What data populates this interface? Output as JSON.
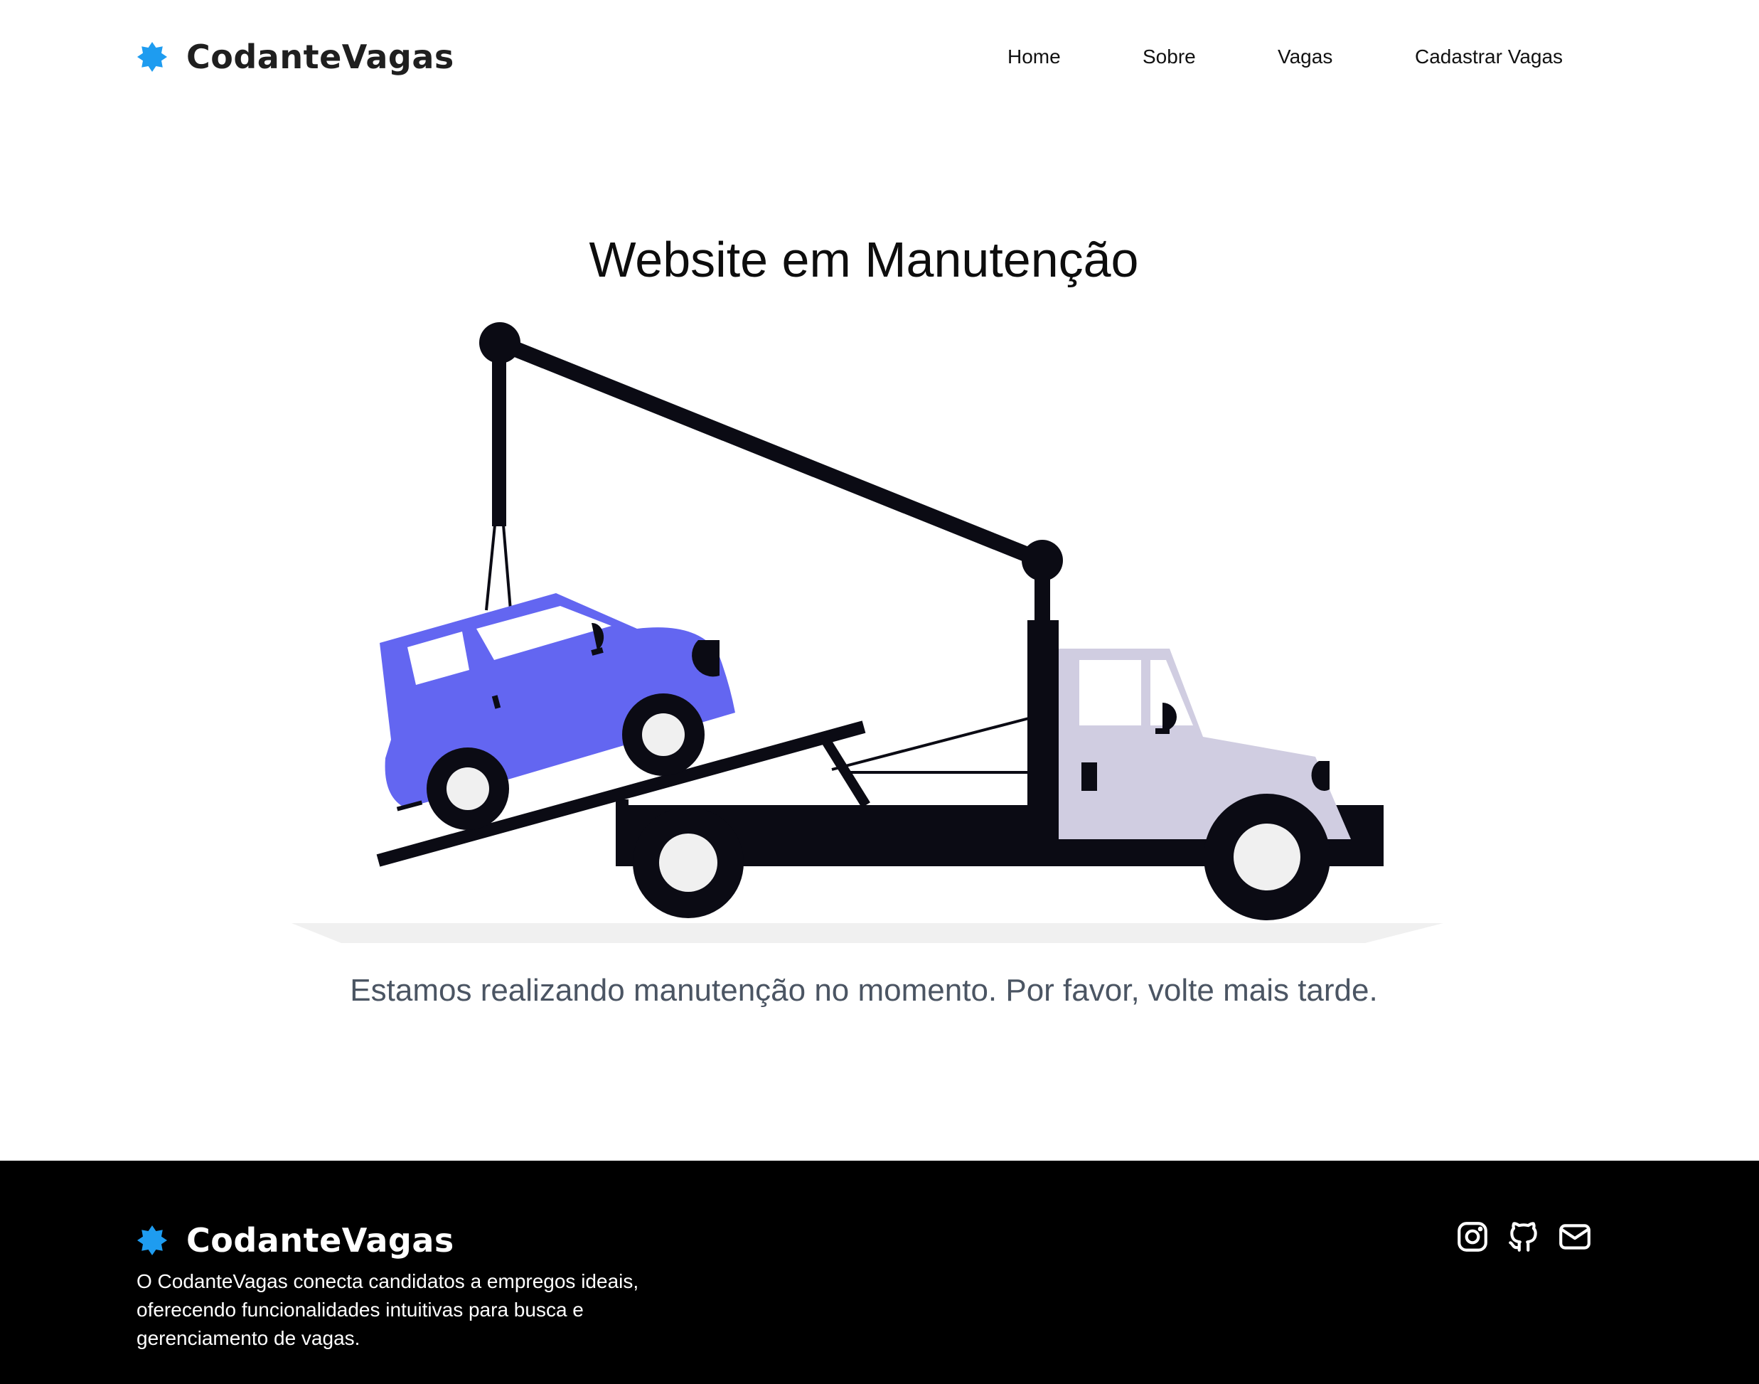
{
  "header": {
    "brand": "CodanteVagas",
    "nav": [
      {
        "label": "Home"
      },
      {
        "label": "Sobre"
      },
      {
        "label": "Vagas"
      },
      {
        "label": "Cadastrar Vagas"
      }
    ]
  },
  "main": {
    "title": "Website em Manutenção",
    "illustration_icon": "tow-truck-lifting-car-illustration",
    "message": "Estamos realizando manutenção no momento. Por favor, volte mais tarde."
  },
  "footer": {
    "brand": "CodanteVagas",
    "description": "O CodanteVagas conecta candidatos a empregos ideais, oferecendo funcionalidades intuitivas para busca e gerenciamento de vagas.",
    "social_icons": [
      "instagram-icon",
      "github-icon",
      "mail-icon"
    ]
  },
  "colors": {
    "brand_star": "#1e9cf0",
    "car": "#6366f1",
    "truck_cab": "#d0cde1",
    "truck_dark": "#0b0b14",
    "footer_bg": "#000000",
    "subtitle_text": "#4b5563"
  }
}
